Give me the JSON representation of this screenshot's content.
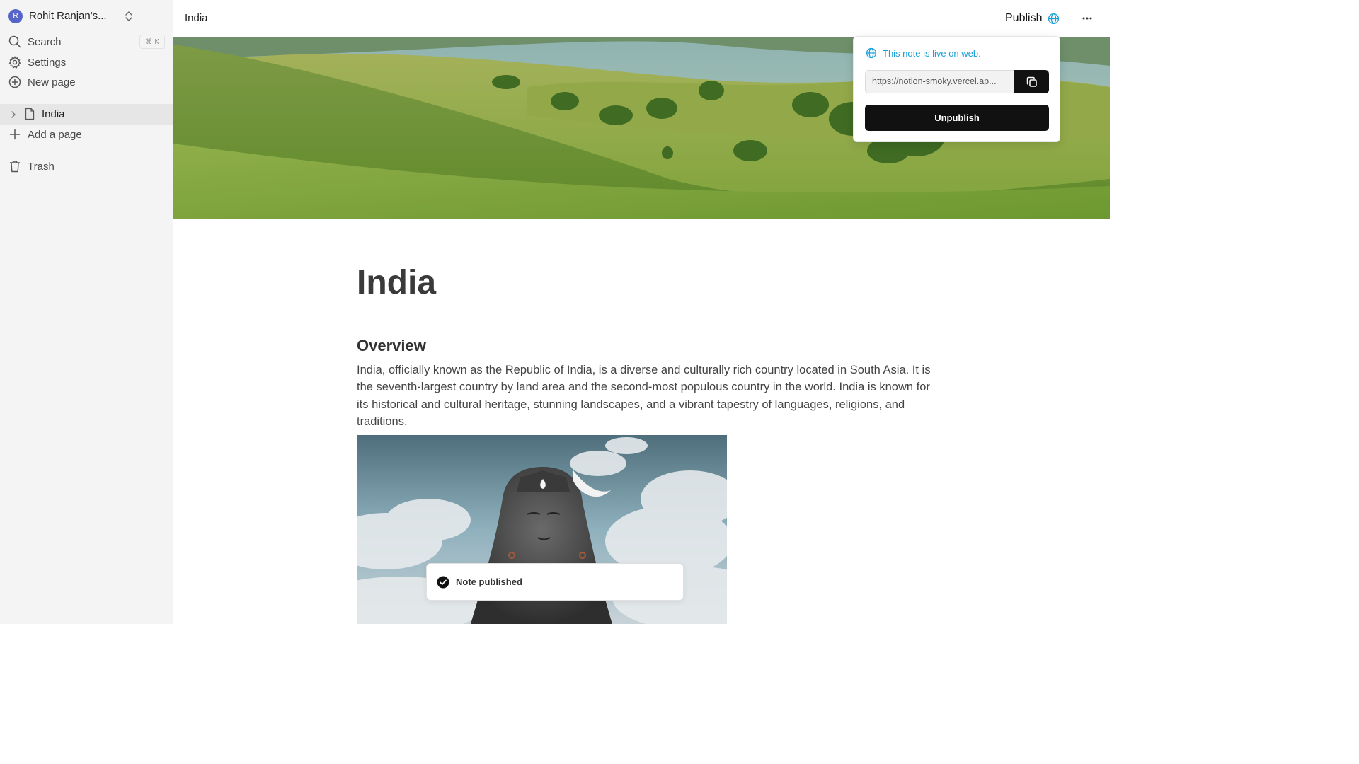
{
  "sidebar": {
    "workspace_initial": "R",
    "workspace_name": "Rohit Ranjan's...",
    "search_label": "Search",
    "search_shortcut": "⌘ K",
    "settings_label": "Settings",
    "new_page_label": "New page",
    "pages": [
      {
        "label": "India"
      }
    ],
    "add_page_label": "Add a page",
    "trash_label": "Trash"
  },
  "topbar": {
    "breadcrumb": "India",
    "publish_label": "Publish"
  },
  "publish_popover": {
    "status": "This note is live on web.",
    "url": "https://notion-smoky.vercel.ap...",
    "unpublish_label": "Unpublish"
  },
  "document": {
    "title": "India",
    "heading": "Overview",
    "paragraph": "India, officially known as the Republic of India, is a diverse and culturally rich country located in South Asia. It is the seventh-largest country by land area and the second-most populous country in the world. India is known for its historical and cultural heritage, stunning landscapes, and a vibrant tapestry of languages, religions, and traditions."
  },
  "toast": {
    "message": "Note published"
  },
  "colors": {
    "accent": "#1aa0d8",
    "primary_button": "#111111",
    "sidebar_bg": "#f4f4f4"
  }
}
